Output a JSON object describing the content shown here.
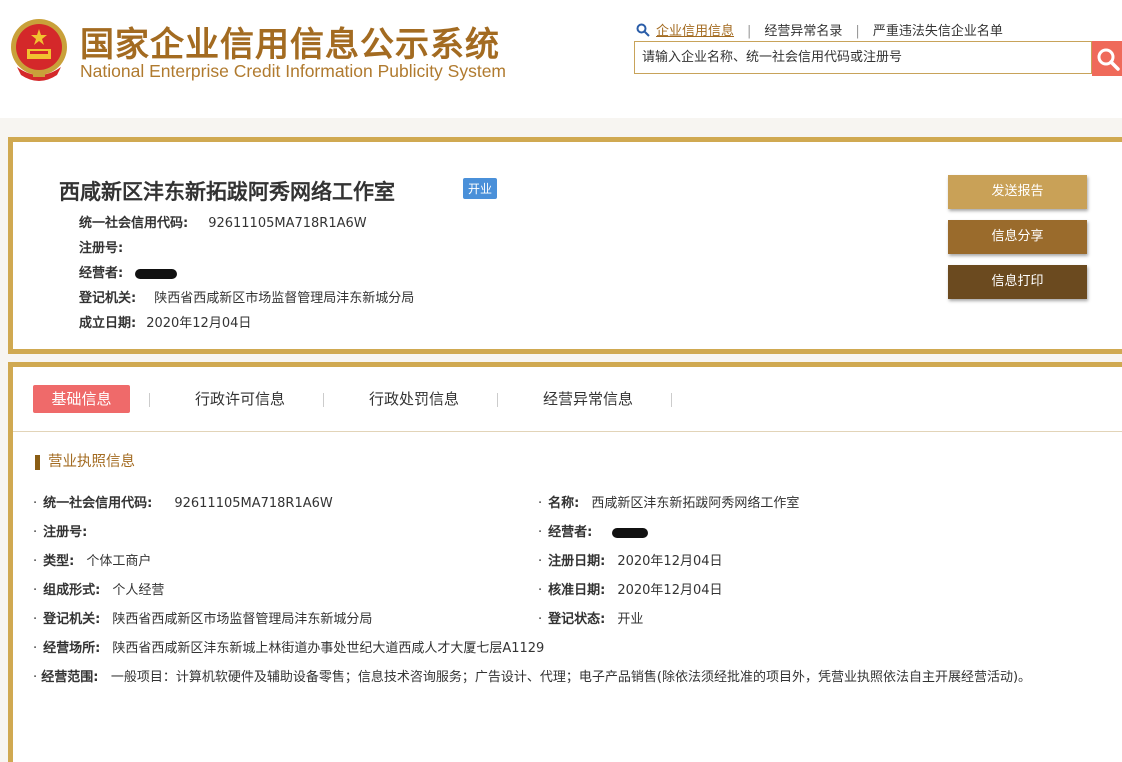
{
  "header": {
    "title_cn": "国家企业信用信息公示系统",
    "title_en": "National Enterprise Credit Information Publicity System",
    "nav": [
      "企业信用信息",
      "经营异常名录",
      "严重违法失信企业名单"
    ],
    "nav_separator": "|",
    "search_placeholder": "请输入企业名称、统一社会信用代码或注册号",
    "colors": {
      "brand_gold": "#a36b21",
      "search_button": "#ef6a5a"
    }
  },
  "company": {
    "name": "西咸新区沣东新拓跋阿秀网络工作室",
    "status": "开业",
    "fields": [
      {
        "label": "统一社会信用代码:",
        "value": "92611105MA718R1A6W"
      },
      {
        "label": "注册号:",
        "value": ""
      },
      {
        "label": "经营者:",
        "value": ""
      },
      {
        "label": "登记机关:",
        "value": "陕西省西咸新区市场监督管理局沣东新城分局"
      },
      {
        "label": "成立日期:",
        "value": "2020年12月04日"
      }
    ],
    "actions": [
      "发送报告",
      "信息分享",
      "信息打印"
    ],
    "action_colors": [
      "#c9a157",
      "#9a6b2c",
      "#6b4a1f"
    ],
    "status_color": "#4a90d9"
  },
  "tabs": [
    "基础信息",
    "行政许可信息",
    "行政处罚信息",
    "经营异常信息"
  ],
  "license": {
    "section_title": "营业执照信息",
    "bullet": "·",
    "left": [
      {
        "label": "统一社会信用代码:",
        "value": "92611105MA718R1A6W"
      },
      {
        "label": "注册号:",
        "value": ""
      },
      {
        "label": "类型:",
        "value": "个体工商户"
      },
      {
        "label": "组成形式:",
        "value": "个人经营"
      },
      {
        "label": "登记机关:",
        "value": "陕西省西咸新区市场监督管理局沣东新城分局"
      },
      {
        "label": "经营场所:",
        "value": "陕西省西咸新区沣东新城上林街道办事处世纪大道西咸人才大厦七层A1129"
      }
    ],
    "right": [
      {
        "label": "名称:",
        "value": "西咸新区沣东新拓跋阿秀网络工作室"
      },
      {
        "label": "经营者:",
        "value": ""
      },
      {
        "label": "注册日期:",
        "value": "2020年12月04日"
      },
      {
        "label": "核准日期:",
        "value": "2020年12月04日"
      },
      {
        "label": "登记状态:",
        "value": "开业"
      }
    ],
    "scope": {
      "label": "经营范围:",
      "value": "一般项目：计算机软硬件及辅助设备零售；信息技术咨询服务；广告设计、代理；电子产品销售(除依法须经批准的项目外，凭营业执照依法自主开展经营活动)。"
    }
  }
}
